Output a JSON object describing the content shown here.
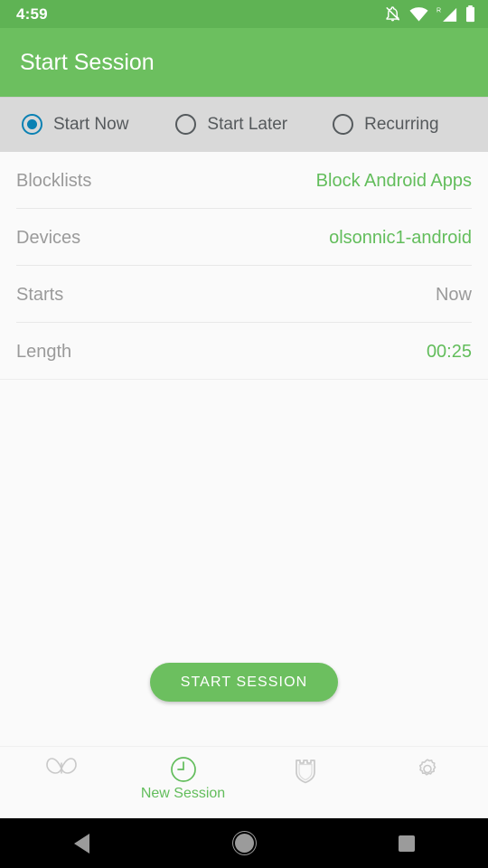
{
  "status_bar": {
    "time": "4:59",
    "icons": [
      "notifications-off-icon",
      "wifi-icon",
      "roaming-signal-icon",
      "battery-icon"
    ]
  },
  "app_bar": {
    "title": "Start Session"
  },
  "mode_tabs": [
    {
      "label": "Start Now",
      "selected": true,
      "name": "start-now"
    },
    {
      "label": "Start Later",
      "selected": false,
      "name": "start-later"
    },
    {
      "label": "Recurring",
      "selected": false,
      "name": "recurring"
    }
  ],
  "rows": [
    {
      "label": "Blocklists",
      "value": "Block Android Apps",
      "value_color": "green"
    },
    {
      "label": "Devices",
      "value": "olsonnic1-android",
      "value_color": "green"
    },
    {
      "label": "Starts",
      "value": "Now",
      "value_color": "grey"
    },
    {
      "label": "Length",
      "value": "00:25",
      "value_color": "green"
    }
  ],
  "primary_action": {
    "label": "START SESSION"
  },
  "bottom_nav": [
    {
      "icon": "butterfly-icon",
      "label": "",
      "active": false
    },
    {
      "icon": "clock-icon",
      "label": "New Session",
      "active": true
    },
    {
      "icon": "shield-icon",
      "label": "",
      "active": false
    },
    {
      "icon": "gear-icon",
      "label": "",
      "active": false
    }
  ],
  "system_nav": {
    "back": "back-button",
    "home": "home-button",
    "recents": "recents-button"
  },
  "colors": {
    "brand_green": "#6cbf5f",
    "status_green": "#5fb354",
    "value_green": "#62bd5b",
    "radio_blue": "#0b81b3",
    "label_grey": "#9a9a9a",
    "tab_bg": "#d9d9d9",
    "page_bg": "#fafafa"
  }
}
